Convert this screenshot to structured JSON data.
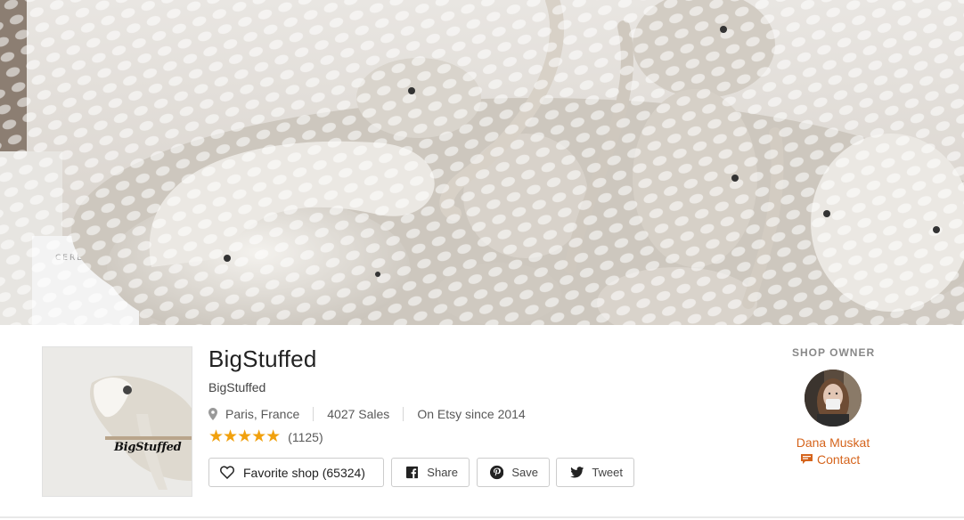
{
  "banner": {
    "alt": "knitted stuffed sea animals"
  },
  "shop": {
    "logo_text": "BigStuffed",
    "name": "BigStuffed",
    "title": "BigStuffed",
    "location": "Paris, France",
    "sales": "4027 Sales",
    "since": "On Etsy since 2014",
    "rating": {
      "stars": "★★★★★",
      "value": 5,
      "max": 5,
      "count": "(1125)"
    }
  },
  "actions": {
    "favorite_label": "Favorite shop (65324)",
    "share_label": "Share",
    "save_label": "Save",
    "tweet_label": "Tweet"
  },
  "owner": {
    "heading": "SHOP OWNER",
    "name": "Dana Muskat",
    "contact_label": "Contact"
  },
  "colors": {
    "accent": "#d5641c",
    "star": "#f1a10e"
  }
}
